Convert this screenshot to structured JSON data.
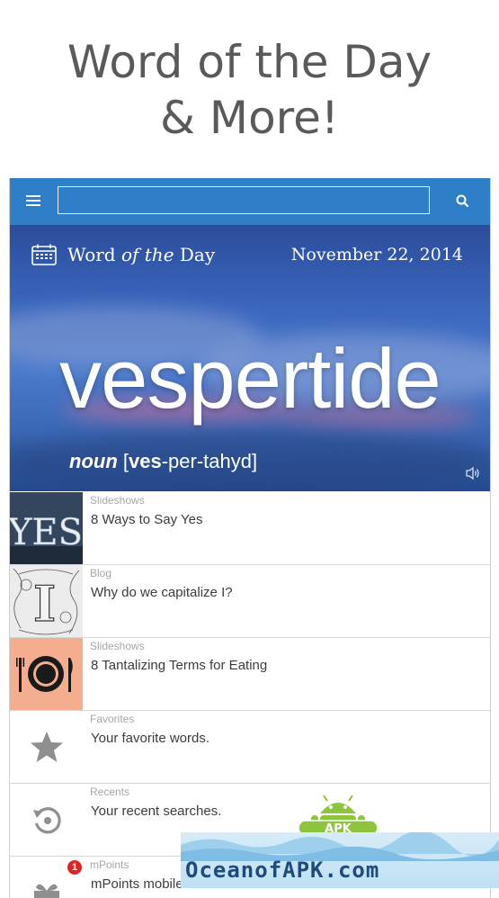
{
  "headline": {
    "line1": "Word of the Day",
    "line2": "& More!"
  },
  "topbar": {
    "search_value": "",
    "menu_icon": "hamburger-menu-icon",
    "search_icon": "search-icon",
    "color": "#2f7fc8"
  },
  "hero": {
    "label_word": "Word",
    "label_of_the": "of the",
    "label_day": "Day",
    "date": "November 22, 2014",
    "word": "vespertide",
    "part_of_speech": "noun",
    "pron_open": "[",
    "pron_stress": "ves",
    "pron_rest": "-per-tahyd]",
    "calendar_icon": "calendar-icon",
    "audio_icon": "speaker-icon"
  },
  "list": [
    {
      "category": "Slideshows",
      "title": "8 Ways to Say Yes",
      "thumb_text": "YES"
    },
    {
      "category": "Blog",
      "title": "Why do we capitalize I?",
      "thumb_text": "I"
    },
    {
      "category": "Slideshows",
      "title": "8 Tantalizing Terms for Eating"
    },
    {
      "category": "Favorites",
      "title": "Your favorite words.",
      "icon": "star-icon"
    },
    {
      "category": "Recents",
      "title": "Your recent searches.",
      "icon": "history-icon"
    },
    {
      "category": "mPoints",
      "title": "mPoints mobile rewards",
      "icon": "rewards-icon",
      "badge": "1"
    }
  ],
  "watermark": {
    "text": "OceanofAPK.com",
    "logo_text": "APK"
  }
}
